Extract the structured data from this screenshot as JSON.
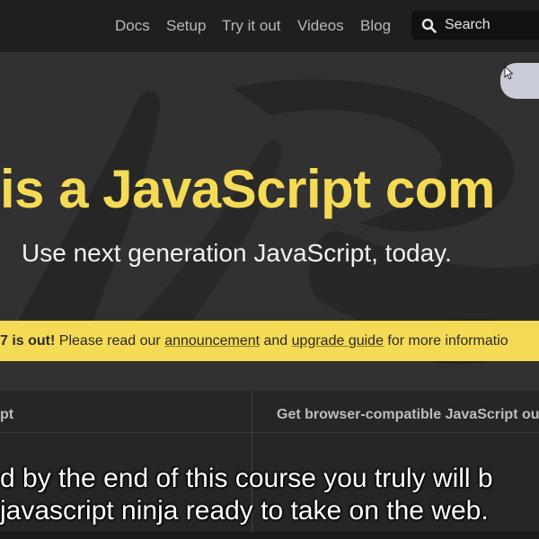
{
  "nav": {
    "links": [
      "Docs",
      "Setup",
      "Try it out",
      "Videos",
      "Blog"
    ],
    "search_label": "Search"
  },
  "hero": {
    "title": "is a JavaScript com",
    "subtitle": "Use next generation JavaScript, today."
  },
  "banner": {
    "bold_text": "7 is out!",
    "text_1": " Please read our ",
    "link_1": "announcement",
    "text_2": " and ",
    "link_2": "upgrade guide",
    "text_3": " for more informatio"
  },
  "features": {
    "left_heading": "pt",
    "right_heading": "Get browser-compatible JavaScript ou"
  },
  "captions": {
    "line_1": "d by the end of this course you truly will b",
    "line_2": "javascript ninja ready to take on the web."
  },
  "colors": {
    "accent_yellow": "#f5da55",
    "nav_background": "#1f1f1f",
    "hero_background": "#313131"
  },
  "icons": {
    "search": "search-icon",
    "cursor": "mouse-pointer-icon"
  }
}
